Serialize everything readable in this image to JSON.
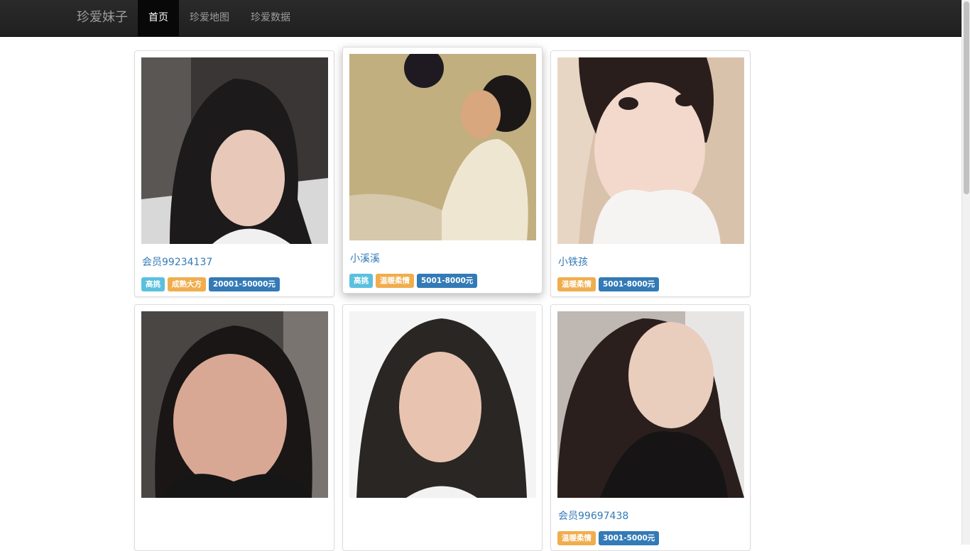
{
  "navbar": {
    "brand": "珍爱妹子",
    "items": [
      {
        "label": "首页",
        "active": true
      },
      {
        "label": "珍爱地图",
        "active": false
      },
      {
        "label": "珍爱数据",
        "active": false
      }
    ]
  },
  "colors": {
    "navbar_bg": "#222222",
    "link": "#337ab7",
    "tag_info": "#5bc0de",
    "tag_warning": "#f0ad4e",
    "tag_primary": "#337ab7"
  },
  "profiles": [
    {
      "name": "会员99234137",
      "tags": [
        {
          "text": "高挑",
          "style": "info"
        },
        {
          "text": "成熟大方",
          "style": "warning"
        },
        {
          "text": "20001-50000元",
          "style": "primary"
        }
      ]
    },
    {
      "name": "小溪溪",
      "tags": [
        {
          "text": "高挑",
          "style": "info"
        },
        {
          "text": "温暖柔情",
          "style": "warning"
        },
        {
          "text": "5001-8000元",
          "style": "primary"
        }
      ]
    },
    {
      "name": "小铁孩",
      "tags": [
        {
          "text": "温暖柔情",
          "style": "warning"
        },
        {
          "text": "5001-8000元",
          "style": "primary"
        }
      ]
    },
    {
      "name": "",
      "tags": []
    },
    {
      "name": "",
      "tags": []
    },
    {
      "name": "会员99697438",
      "tags": [
        {
          "text": "温暖柔情",
          "style": "warning"
        },
        {
          "text": "3001-5000元",
          "style": "primary"
        }
      ]
    }
  ]
}
